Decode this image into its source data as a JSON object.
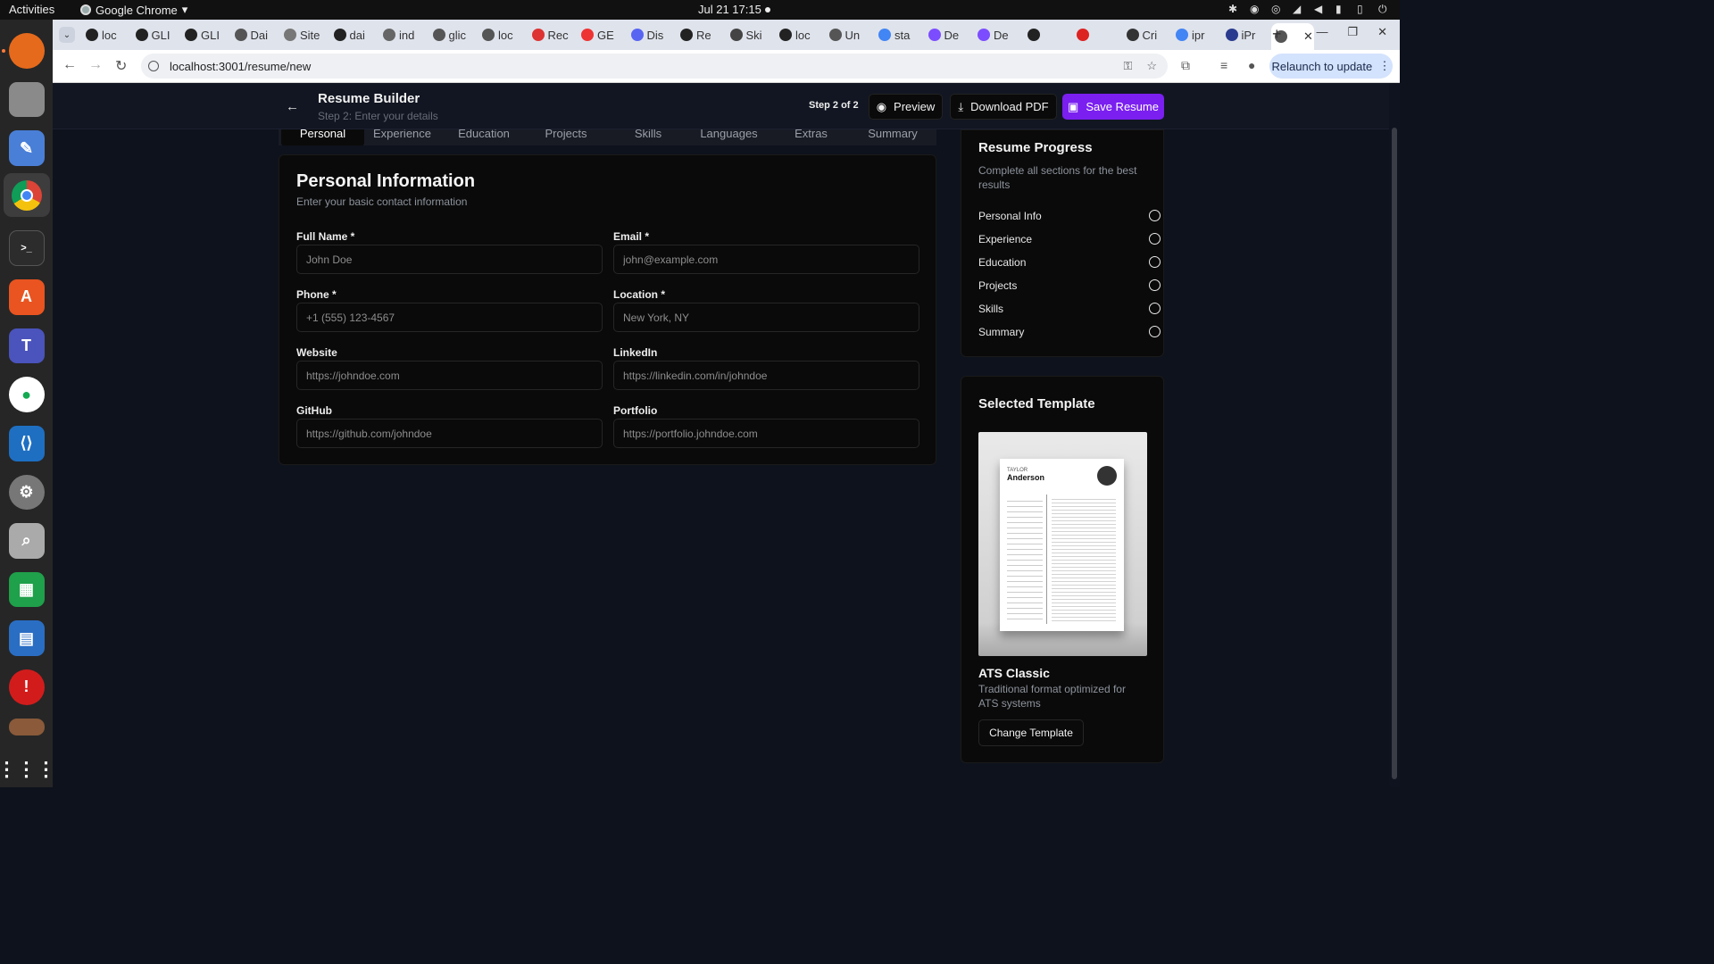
{
  "system": {
    "activities": "Activities",
    "app_name": "Google Chrome",
    "clock": "Jul 21  17:15"
  },
  "browser": {
    "tabs": [
      {
        "label": "loc"
      },
      {
        "label": "GLI"
      },
      {
        "label": "GLI"
      },
      {
        "label": "Dai"
      },
      {
        "label": "Site"
      },
      {
        "label": "dai"
      },
      {
        "label": "ind"
      },
      {
        "label": "glic"
      },
      {
        "label": "loc"
      },
      {
        "label": "Rec"
      },
      {
        "label": "GE"
      },
      {
        "label": "Dis"
      },
      {
        "label": "Re"
      },
      {
        "label": "Ski"
      },
      {
        "label": "loc"
      },
      {
        "label": "Un"
      },
      {
        "label": "sta"
      },
      {
        "label": "De"
      },
      {
        "label": "De"
      },
      {
        "label": ""
      },
      {
        "label": ""
      },
      {
        "label": "Cri"
      },
      {
        "label": "ipr"
      },
      {
        "label": "iPr"
      },
      {
        "label": ""
      }
    ],
    "url": "localhost:3001/resume/new",
    "relaunch_label": "Relaunch to update"
  },
  "header": {
    "title": "Resume Builder",
    "subtitle": "Step 2: Enter your details",
    "step": "Step 2 of 2",
    "preview_label": "Preview",
    "download_label": "Download PDF",
    "save_label": "Save Resume"
  },
  "section_tabs": [
    "Personal",
    "Experience",
    "Education",
    "Projects",
    "Skills",
    "Languages",
    "Extras",
    "Summary"
  ],
  "personal": {
    "title": "Personal Information",
    "subtitle": "Enter your basic contact information",
    "fields": [
      {
        "label": "Full Name *",
        "placeholder": "John Doe"
      },
      {
        "label": "Email *",
        "placeholder": "john@example.com"
      },
      {
        "label": "Phone *",
        "placeholder": "+1 (555) 123-4567"
      },
      {
        "label": "Location *",
        "placeholder": "New York, NY"
      },
      {
        "label": "Website",
        "placeholder": "https://johndoe.com"
      },
      {
        "label": "LinkedIn",
        "placeholder": "https://linkedin.com/in/johndoe"
      },
      {
        "label": "GitHub",
        "placeholder": "https://github.com/johndoe"
      },
      {
        "label": "Portfolio",
        "placeholder": "https://portfolio.johndoe.com"
      }
    ]
  },
  "progress": {
    "title": "Resume Progress",
    "description": "Complete all sections for the best results",
    "items": [
      "Personal Info",
      "Experience",
      "Education",
      "Projects",
      "Skills",
      "Summary"
    ]
  },
  "template": {
    "heading": "Selected Template",
    "preview_name_top": "TAYLOR",
    "preview_name": "Anderson",
    "name": "ATS Classic",
    "description": "Traditional format optimized for ATS systems",
    "change_label": "Change Template"
  },
  "colors": {
    "accent": "#7a1ff0",
    "background": "#0e121c",
    "card": "#0a0a0a"
  }
}
